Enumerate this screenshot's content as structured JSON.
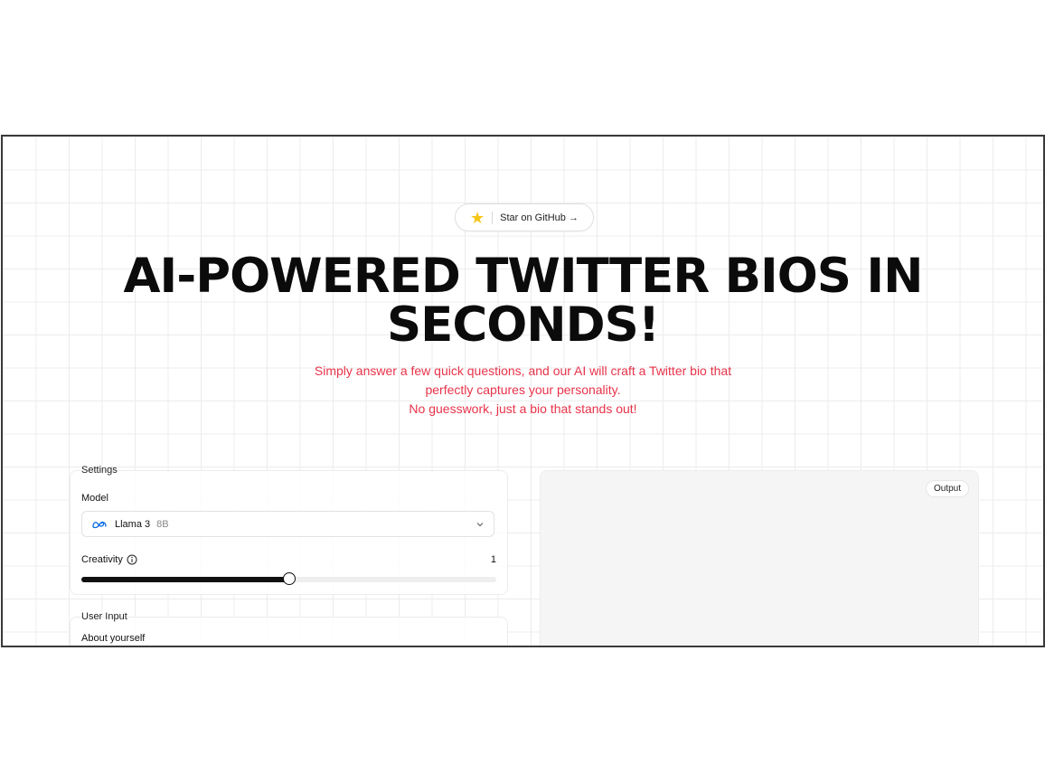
{
  "github_pill": {
    "icon": "star-icon",
    "label": "Star on GitHub →"
  },
  "headline": {
    "line1": "AI-POWERED TWITTER BIOS IN",
    "line2": "SECONDS!"
  },
  "subtitle": {
    "line1": "Simply answer a few quick questions, and our AI will craft a Twitter bio that",
    "line2": "perfectly captures your personality.",
    "line3": "No guesswork, just a bio that stands out!"
  },
  "settings": {
    "title": "Settings",
    "model_label": "Model",
    "model": {
      "icon": "meta-icon",
      "name": "Llama 3",
      "size": "8B"
    },
    "creativity_label": "Creativity",
    "creativity_value": "1",
    "creativity_fraction": 0.5
  },
  "user_input": {
    "title": "User Input",
    "about_label": "About yourself"
  },
  "output": {
    "label": "Output"
  },
  "colors": {
    "accent": "#e8334a",
    "star": "#f5c518",
    "meta": "#0668e1"
  }
}
